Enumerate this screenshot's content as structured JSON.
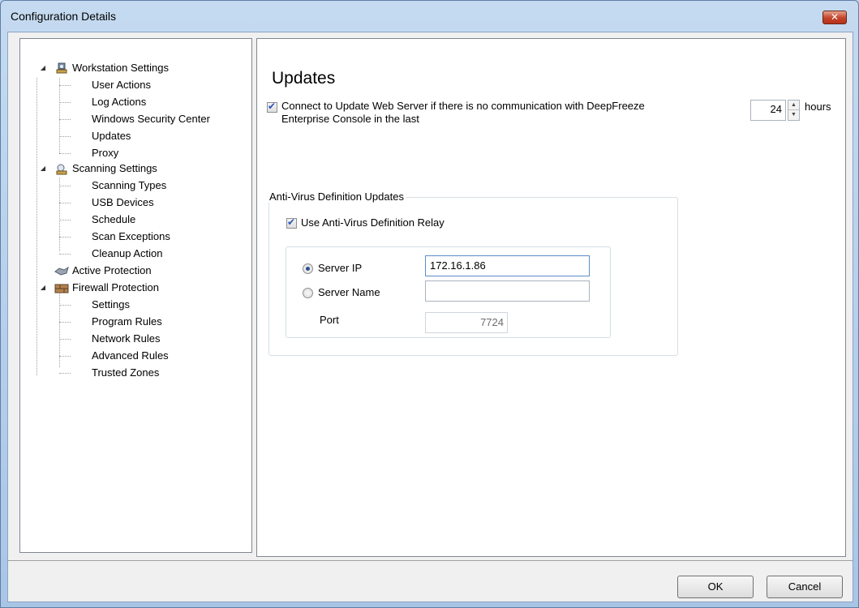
{
  "window": {
    "title": "Configuration Details",
    "close_symbol": "✕"
  },
  "tree": {
    "workstation": {
      "label": "Workstation Settings",
      "children": [
        "User Actions",
        "Log Actions",
        "Windows Security Center",
        "Updates",
        "Proxy"
      ]
    },
    "scanning": {
      "label": "Scanning Settings",
      "children": [
        "Scanning Types",
        "USB Devices",
        "Schedule",
        "Scan Exceptions",
        "Cleanup Action"
      ]
    },
    "active": {
      "label": "Active Protection"
    },
    "firewall": {
      "label": "Firewall Protection",
      "children": [
        "Settings",
        "Program Rules",
        "Network Rules",
        "Advanced Rules",
        "Trusted Zones"
      ]
    }
  },
  "content": {
    "title": "Updates",
    "connect_label_line1": "Connect to Update Web Server if there is no communication with DeepFreeze",
    "connect_label_line2": "Enterprise Console in the last",
    "connect_checked": true,
    "hours_value": "24",
    "hours_label": "hours",
    "group_title": "Anti-Virus Definition Updates",
    "relay_label": "Use Anti-Virus Definition Relay",
    "relay_checked": true,
    "server_ip_label": "Server IP",
    "server_ip_value": "172.16.1.86",
    "server_name_label": "Server Name",
    "server_name_value": "",
    "port_label": "Port",
    "port_value": "7724",
    "selected_option": "Server IP"
  },
  "footer": {
    "ok_label": "OK",
    "cancel_label": "Cancel"
  }
}
